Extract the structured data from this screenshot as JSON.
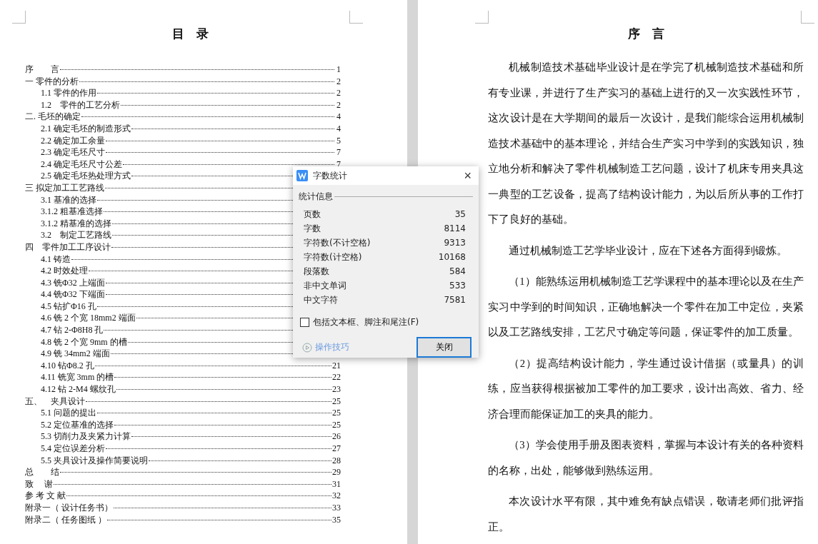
{
  "toc_page": {
    "title": "目　录",
    "entries": [
      {
        "label": "序　　言",
        "page": "1"
      },
      {
        "label": "一 零件的分析",
        "page": "2",
        "children": [
          {
            "label": "1.1 零件的作用",
            "page": "2"
          },
          {
            "label": "1.2　零件的工艺分析",
            "page": "2"
          }
        ]
      },
      {
        "label": "二. 毛坯的确定",
        "page": "4",
        "children": [
          {
            "label": "2.1 确定毛坯的制造形式",
            "page": "4"
          },
          {
            "label": "2.2 确定加工余量",
            "page": "5"
          },
          {
            "label": "2.3 确定毛坯尺寸",
            "page": "7"
          },
          {
            "label": "2.4 确定毛坯尺寸公差",
            "page": "7"
          },
          {
            "label": "2.5 确定毛坯热处理方式"
          }
        ]
      },
      {
        "label": "三 拟定加工工艺路线",
        "children": [
          {
            "label": "3.1 基准的选择"
          },
          {
            "label": "3.1.2 粗基准选择"
          },
          {
            "label": "3.1.2 精基准的选择"
          },
          {
            "label": "3.2　制定工艺路线"
          }
        ]
      },
      {
        "label": "四　零件加工工序设计",
        "children": [
          {
            "label": "4.1 铸造"
          },
          {
            "label": "4.2 时效处理"
          },
          {
            "label": "4.3 铣Φ32 上端面"
          },
          {
            "label": "4.4 铣Φ32 下端面"
          },
          {
            "label": "4.5 钻扩Φ16 孔"
          },
          {
            "label": "4.6 铣 2 个宽 18mm2 端面"
          },
          {
            "label": "4.7 钻 2-Φ8H8 孔"
          },
          {
            "label": "4.8 铣 2 个宽 9mm 的槽"
          },
          {
            "label": "4.9 铣 34mm2 端面"
          },
          {
            "label": "4.10 钻Φ8.2 孔",
            "page": "21"
          },
          {
            "label": "4.11 铣宽 3mm 的槽",
            "page": "22"
          },
          {
            "label": "4.12 钻 2-M4 螺纹孔",
            "page": "23"
          }
        ]
      },
      {
        "label": "五、　夹具设计",
        "page": "25",
        "children": [
          {
            "label": "5.1 问题的提出",
            "page": "25"
          },
          {
            "label": "5.2 定位基准的选择",
            "page": "25"
          },
          {
            "label": "5.3 切削力及夹紧力计算",
            "page": "26"
          },
          {
            "label": "5.4 定位误差分析",
            "page": "27"
          },
          {
            "label": "5.5 夹具设计及操作简要说明",
            "page": "28"
          }
        ]
      },
      {
        "label": "总　　结",
        "page": "29"
      },
      {
        "label": "致　 谢",
        "page": "31"
      },
      {
        "label": "参 考 文 献",
        "page": "32"
      },
      {
        "label": "附录一（ 设计任务书）",
        "page": "33"
      },
      {
        "label": "附录二（ 任务图纸 ）",
        "page": "35"
      }
    ]
  },
  "preface_page": {
    "title": "序　言",
    "paragraphs": [
      "机械制造技术基础毕业设计是在学完了机械制造技术基础和所有专业课，并进行了生产实习的基础上进行的又一次实践性环节，这次设计是在大学期间的最后一次设计，是我们能综合运用机械制造技术基础中的基本理论，并结合生产实习中学到的实践知识，独立地分析和解决了零件机械制造工艺问题，设计了机床专用夹具这一典型的工艺设备，提高了结构设计能力，为以后所从事的工作打下了良好的基础。",
      "通过机械制造工艺学毕业设计，应在下述各方面得到锻炼。",
      "（1）能熟练运用机械制造工艺学课程中的基本理论以及在生产实习中学到的时间知识，正确地解决一个零件在加工中定位，夹紧以及工艺路线安排，工艺尺寸确定等问题，保证零件的加工质量。",
      "（2）提高结构设计能力，学生通过设计借据（或量具）的训练，应当获得根据被加工零件的加工要求，设计出高效、省力、经济合理而能保证加工的夹具的能力。",
      "（3）学会使用手册及图表资料，掌握与本设计有关的各种资料的名称，出处，能够做到熟练运用。",
      "本次设计水平有限，其中难免有缺点错误，敬请老师们批评指正。"
    ]
  },
  "dialog": {
    "title": "字数统计",
    "close_glyph": "×",
    "section": "统计信息",
    "stats": [
      {
        "label": "页数",
        "value": "35"
      },
      {
        "label": "字数",
        "value": "8114"
      },
      {
        "label": "字符数(不计空格)",
        "value": "9313"
      },
      {
        "label": "字符数(计空格)",
        "value": "10168"
      },
      {
        "label": "段落数",
        "value": "584"
      },
      {
        "label": "非中文单词",
        "value": "533"
      },
      {
        "label": "中文字符",
        "value": "7581"
      }
    ],
    "checkbox": {
      "label": "包括文本框、脚注和尾注(F)",
      "checked": false
    },
    "tips_link": "操作技巧",
    "button": "关闭"
  }
}
